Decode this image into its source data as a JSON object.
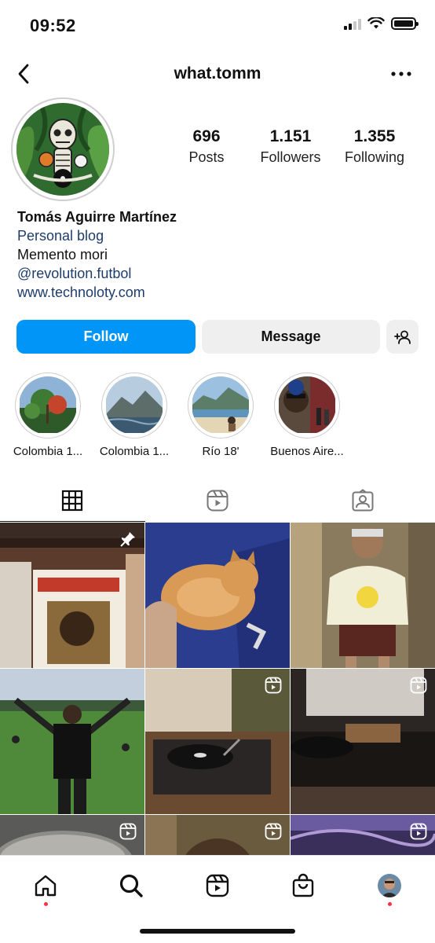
{
  "status_bar": {
    "time": "09:52"
  },
  "header": {
    "username": "what.tomm"
  },
  "profile": {
    "stats": [
      {
        "value": "696",
        "label": "Posts"
      },
      {
        "value": "1.151",
        "label": "Followers"
      },
      {
        "value": "1.355",
        "label": "Following"
      }
    ],
    "name": "Tomás Aguirre Martínez",
    "category": "Personal blog",
    "bio": "Memento mori",
    "mention": "@revolution.futbol",
    "website": "www.technoloty.com"
  },
  "actions": {
    "follow_label": "Follow",
    "message_label": "Message"
  },
  "highlights": [
    {
      "label": "Colombia 1..."
    },
    {
      "label": "Colombia 1..."
    },
    {
      "label": "Río 18'"
    },
    {
      "label": "Buenos Aire..."
    }
  ],
  "tabs": [
    {
      "icon": "grid-icon"
    },
    {
      "icon": "reels-icon"
    },
    {
      "icon": "tagged-icon"
    }
  ],
  "grid_posts": [
    {
      "badge": "pinned-icon"
    },
    {
      "badge": ""
    },
    {
      "badge": ""
    },
    {
      "badge": ""
    },
    {
      "badge": "reel-icon"
    },
    {
      "badge": "reel-icon"
    },
    {
      "badge": "reel-icon"
    },
    {
      "badge": "reel-icon"
    },
    {
      "badge": "reel-icon"
    }
  ],
  "bottom_nav": [
    "home-icon",
    "search-icon",
    "reels-icon",
    "shop-icon",
    "profile-avatar"
  ],
  "colors": {
    "accent": "#0095f6",
    "link": "#1f3d6b",
    "notification": "#ff3040"
  }
}
